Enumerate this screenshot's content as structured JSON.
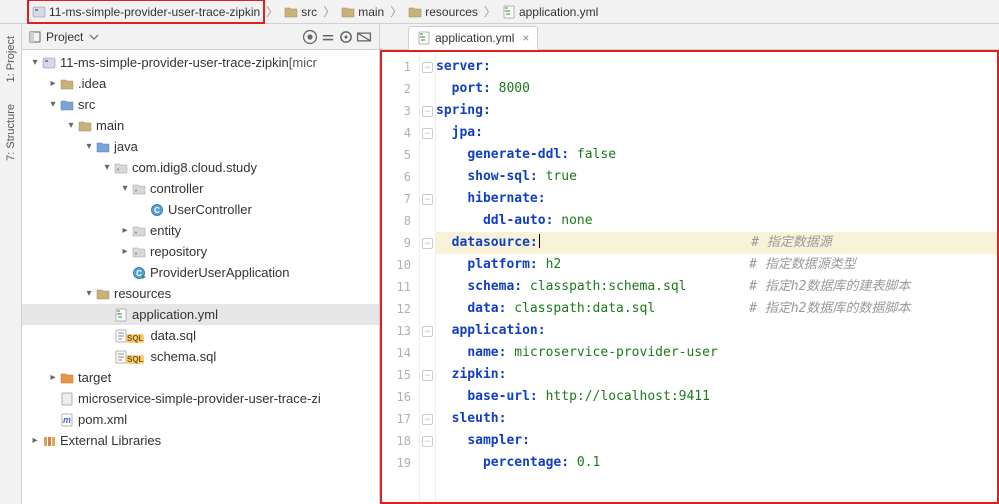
{
  "breadcrumbs": [
    {
      "label": "11-ms-simple-provider-user-trace-zipkin",
      "icon": "module"
    },
    {
      "label": "src",
      "icon": "folder"
    },
    {
      "label": "main",
      "icon": "folder"
    },
    {
      "label": "resources",
      "icon": "resources-folder"
    },
    {
      "label": "application.yml",
      "icon": "yml-file"
    }
  ],
  "side_tabs": {
    "project": "1: Project",
    "structure": "7: Structure"
  },
  "project_panel": {
    "title": "Project"
  },
  "tree": [
    {
      "depth": 0,
      "exp": "open",
      "icon": "module",
      "label": "11-ms-simple-provider-user-trace-zipkin",
      "suffix": " [micr"
    },
    {
      "depth": 1,
      "exp": "closed",
      "icon": "folder",
      "label": ".idea"
    },
    {
      "depth": 1,
      "exp": "open",
      "icon": "folder-src",
      "label": "src"
    },
    {
      "depth": 2,
      "exp": "open",
      "icon": "folder",
      "label": "main"
    },
    {
      "depth": 3,
      "exp": "open",
      "icon": "folder-src",
      "label": "java"
    },
    {
      "depth": 4,
      "exp": "open",
      "icon": "package",
      "label": "com.idig8.cloud.study"
    },
    {
      "depth": 5,
      "exp": "open",
      "icon": "package",
      "label": "controller"
    },
    {
      "depth": 6,
      "exp": "none",
      "icon": "class",
      "label": "UserController"
    },
    {
      "depth": 5,
      "exp": "closed",
      "icon": "package",
      "label": "entity"
    },
    {
      "depth": 5,
      "exp": "closed",
      "icon": "package",
      "label": "repository"
    },
    {
      "depth": 5,
      "exp": "none",
      "icon": "class-run",
      "label": "ProviderUserApplication"
    },
    {
      "depth": 3,
      "exp": "open",
      "icon": "resources-folder",
      "label": "resources"
    },
    {
      "depth": 4,
      "exp": "none",
      "icon": "yml-file",
      "label": "application.yml",
      "selected": true
    },
    {
      "depth": 4,
      "exp": "none",
      "icon": "sql-file",
      "label": "data.sql"
    },
    {
      "depth": 4,
      "exp": "none",
      "icon": "sql-file",
      "label": "schema.sql"
    },
    {
      "depth": 1,
      "exp": "closed",
      "icon": "folder-target",
      "label": "target"
    },
    {
      "depth": 1,
      "exp": "none",
      "icon": "file",
      "label": "microservice-simple-provider-user-trace-zi"
    },
    {
      "depth": 1,
      "exp": "none",
      "icon": "maven",
      "label": "pom.xml"
    },
    {
      "depth": 0,
      "exp": "closed",
      "icon": "lib",
      "label": "External Libraries"
    }
  ],
  "editor_tab": {
    "label": "application.yml"
  },
  "code": {
    "lines": [
      {
        "n": 1,
        "fold": true,
        "indent": 0,
        "key": "server:",
        "val": "",
        "com": ""
      },
      {
        "n": 2,
        "fold": false,
        "indent": 1,
        "key": "port:",
        "val": " 8000",
        "com": ""
      },
      {
        "n": 3,
        "fold": true,
        "indent": 0,
        "key": "spring:",
        "val": "",
        "com": ""
      },
      {
        "n": 4,
        "fold": true,
        "indent": 1,
        "key": "jpa:",
        "val": "",
        "com": ""
      },
      {
        "n": 5,
        "fold": false,
        "indent": 2,
        "key": "generate-ddl:",
        "val": " false",
        "com": ""
      },
      {
        "n": 6,
        "fold": false,
        "indent": 2,
        "key": "show-sql:",
        "val": " true",
        "com": ""
      },
      {
        "n": 7,
        "fold": true,
        "indent": 2,
        "key": "hibernate:",
        "val": "",
        "com": ""
      },
      {
        "n": 8,
        "fold": false,
        "indent": 3,
        "key": "ddl-auto:",
        "val": " none",
        "com": ""
      },
      {
        "n": 9,
        "fold": true,
        "indent": 1,
        "key": "datasource:",
        "val": "",
        "com": "# 指定数据源",
        "hl": true,
        "caret": true
      },
      {
        "n": 10,
        "fold": false,
        "indent": 2,
        "key": "platform:",
        "val": " h2",
        "com": "# 指定数据源类型"
      },
      {
        "n": 11,
        "fold": false,
        "indent": 2,
        "key": "schema:",
        "val": " classpath:schema.sql",
        "com": "# 指定h2数据库的建表脚本"
      },
      {
        "n": 12,
        "fold": false,
        "indent": 2,
        "key": "data:",
        "val": " classpath:data.sql",
        "com": "# 指定h2数据库的数据脚本"
      },
      {
        "n": 13,
        "fold": true,
        "indent": 1,
        "key": "application:",
        "val": "",
        "com": ""
      },
      {
        "n": 14,
        "fold": false,
        "indent": 2,
        "key": "name:",
        "val": " microservice-provider-user",
        "com": ""
      },
      {
        "n": 15,
        "fold": true,
        "indent": 1,
        "key": "zipkin:",
        "val": "",
        "com": ""
      },
      {
        "n": 16,
        "fold": false,
        "indent": 2,
        "key": "base-url:",
        "val": " http://localhost:9411",
        "com": ""
      },
      {
        "n": 17,
        "fold": true,
        "indent": 1,
        "key": "sleuth:",
        "val": "",
        "com": ""
      },
      {
        "n": 18,
        "fold": true,
        "indent": 2,
        "key": "sampler:",
        "val": "",
        "com": ""
      },
      {
        "n": 19,
        "fold": false,
        "indent": 3,
        "key": "percentage:",
        "val": " 0.1",
        "com": ""
      }
    ],
    "comment_col": 40
  }
}
